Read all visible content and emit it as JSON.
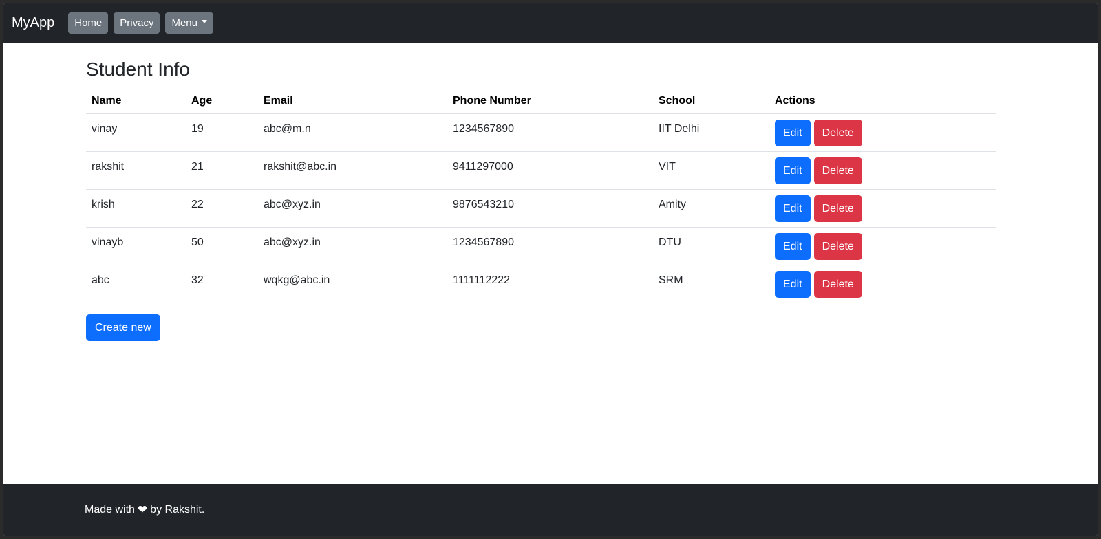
{
  "navbar": {
    "brand": "MyApp",
    "items": [
      {
        "label": "Home"
      },
      {
        "label": "Privacy"
      },
      {
        "label": "Menu"
      }
    ]
  },
  "page": {
    "title": "Student Info"
  },
  "table": {
    "headers": [
      "Name",
      "Age",
      "Email",
      "Phone Number",
      "School",
      "Actions"
    ],
    "rows": [
      {
        "name": "vinay",
        "age": "19",
        "email": "abc@m.n",
        "phone": "1234567890",
        "school": "IIT Delhi"
      },
      {
        "name": "rakshit",
        "age": "21",
        "email": "rakshit@abc.in",
        "phone": "9411297000",
        "school": "VIT"
      },
      {
        "name": "krish",
        "age": "22",
        "email": "abc@xyz.in",
        "phone": "9876543210",
        "school": "Amity"
      },
      {
        "name": "vinayb",
        "age": "50",
        "email": "abc@xyz.in",
        "phone": "1234567890",
        "school": "DTU"
      },
      {
        "name": "abc",
        "age": "32",
        "email": "wqkg@abc.in",
        "phone": "1111112222",
        "school": "SRM"
      }
    ],
    "edit_label": "Edit",
    "delete_label": "Delete"
  },
  "create_label": "Create new",
  "footer": {
    "prefix": "Made with",
    "icon": "heart-icon",
    "suffix": "by Rakshit."
  },
  "colors": {
    "navbar_bg": "#212529",
    "nav_button_bg": "#6c757d",
    "primary": "#0d6efd",
    "danger": "#dc3545"
  }
}
